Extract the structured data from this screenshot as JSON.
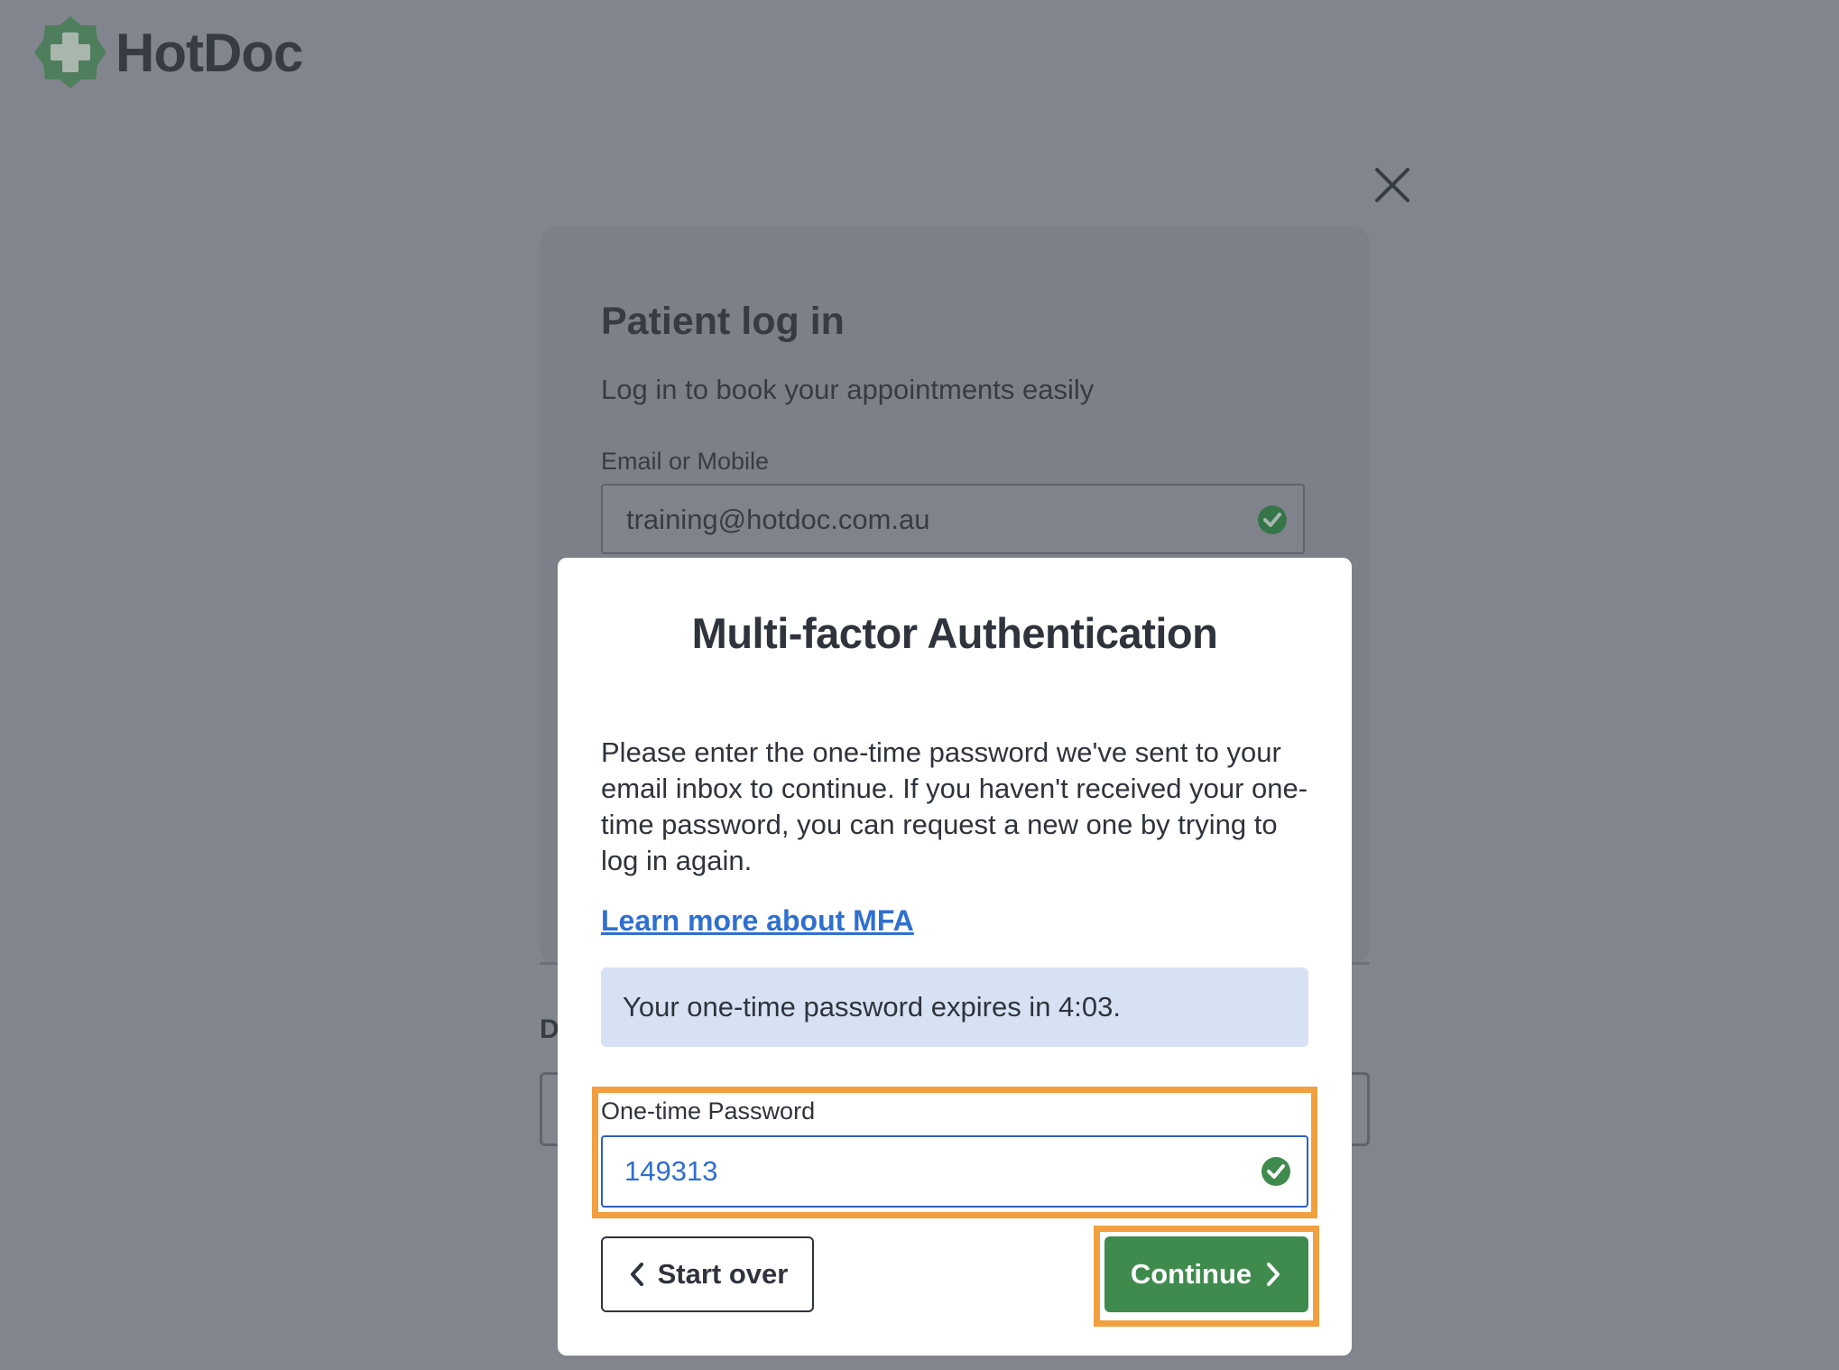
{
  "brand": {
    "name": "HotDoc",
    "logo_icon": "medical-cross-icon",
    "logo_color": "#4f7e5d"
  },
  "close_icon": "close-icon",
  "login_card": {
    "title": "Patient log in",
    "subtitle": "Log in to book your appointments easily",
    "email_label": "Email or Mobile",
    "email_value": "training@hotdoc.com.au",
    "email_valid_icon": "check-circle-icon",
    "partial_heading": "D"
  },
  "mfa_modal": {
    "title": "Multi-factor Authentication",
    "body": "Please enter the one-time password we've sent to your email inbox to continue. If you haven't received your one-time password, you can request a new one by trying to log in again.",
    "learn_more_link": "Learn more about MFA",
    "expiry_notice": "Your one-time password expires in 4:03.",
    "otp_label": "One-time Password",
    "otp_value": "149313",
    "otp_valid_icon": "check-circle-icon",
    "start_over_label": "Start over",
    "start_over_icon": "chevron-left-icon",
    "continue_label": "Continue",
    "continue_icon": "chevron-right-icon"
  },
  "colors": {
    "overlay": "#82858d",
    "primary_green": "#3f8b4d",
    "link_blue": "#2f6fd0",
    "highlight_orange": "#f19f3f",
    "info_banner": "#d6e2f4",
    "text_dark": "#2f333b"
  }
}
